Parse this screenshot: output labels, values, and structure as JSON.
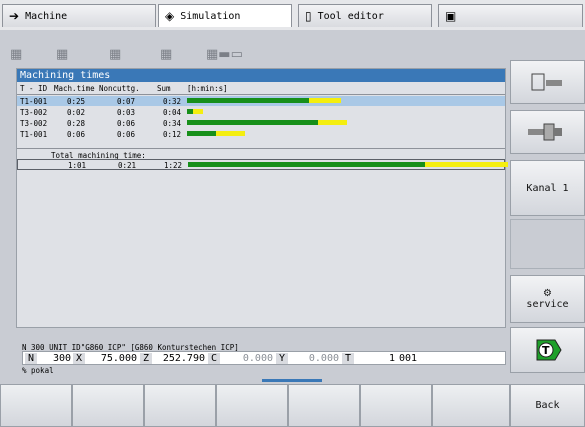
{
  "tabs": [
    {
      "label": "Machine",
      "icon": "arrow-right-icon"
    },
    {
      "label": "Simulation",
      "icon": "diamond-arrow-icon"
    },
    {
      "label": "Tool editor",
      "icon": "door-icon"
    },
    {
      "label": "",
      "icon": "save-icon"
    }
  ],
  "panel": {
    "title": "Machining times",
    "headers": {
      "tid": "T - ID",
      "mach": "Mach.time",
      "non": "Noncuttg.",
      "sum": "Sum",
      "unit": "[h:min:s]"
    },
    "rows": [
      {
        "tid": "T1-001",
        "mach": "0:25",
        "non": "0:07",
        "sum": "0:32",
        "green": 0.38,
        "yellow": 0.1,
        "selected": true
      },
      {
        "tid": "T3-002",
        "mach": "0:02",
        "non": "0:03",
        "sum": "0:04",
        "green": 0.02,
        "yellow": 0.03,
        "selected": false
      },
      {
        "tid": "T3-002",
        "mach": "0:28",
        "non": "0:06",
        "sum": "0:34",
        "green": 0.41,
        "yellow": 0.09,
        "selected": false
      },
      {
        "tid": "T1-001",
        "mach": "0:06",
        "non": "0:06",
        "sum": "0:12",
        "green": 0.09,
        "yellow": 0.09,
        "selected": false
      }
    ],
    "total_label": "Total machining time:",
    "total": {
      "mach": "1:01",
      "non": "0:21",
      "sum": "1:22",
      "green": 0.74,
      "yellow": 0.26
    }
  },
  "nc": {
    "line": "N 300 UNIT ID\"G860_ICP\" [G860 Konturstechen ICP]",
    "N": "300",
    "X": "75.000",
    "Z": "252.790",
    "C": "0.000",
    "Y": "0.000",
    "T": "1",
    "T2": "001",
    "labels": {
      "n": "N",
      "x": "X",
      "z": "Z",
      "c": "C",
      "y": "Y",
      "t": "T"
    },
    "comment": "% pokal"
  },
  "softkeys": {
    "kanal": "Kanal 1",
    "service": "service",
    "back": "Back"
  },
  "colors": {
    "title": "#3a78b7",
    "selected": "#a9c8e6",
    "green": "#178f1a",
    "yellow": "#f4ee10"
  }
}
